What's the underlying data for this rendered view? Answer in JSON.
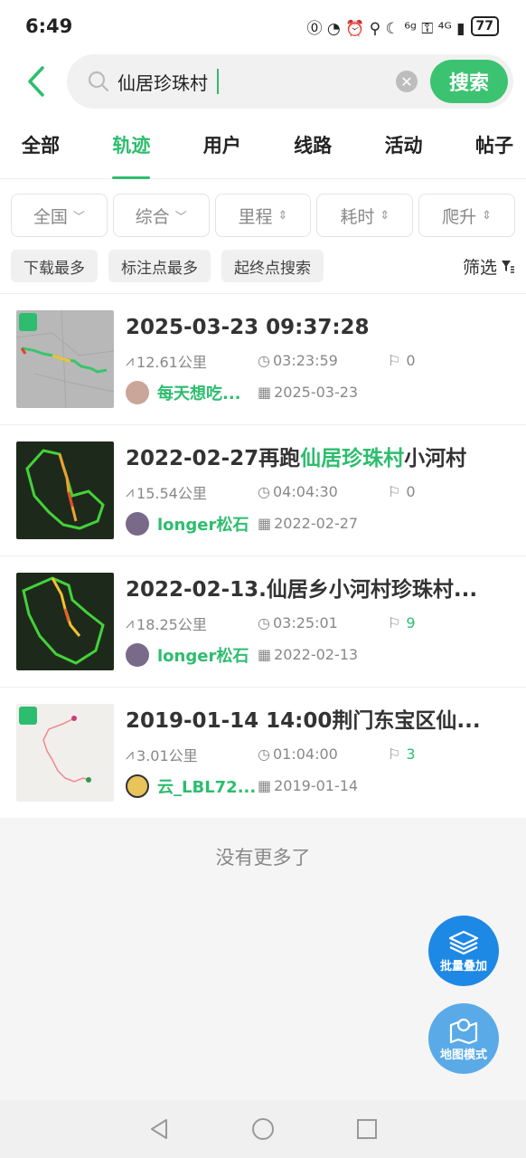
{
  "status_bar": {
    "time": "6:49",
    "icons_text": "⓪ ◔ ⏰ ⚲ ☾ ⁶ᵍ ⚿ ⁴ᴳ ▮",
    "battery": "77"
  },
  "search": {
    "query": "仙居珍珠村",
    "button_label": "搜索"
  },
  "tabs": [
    {
      "label": "全部",
      "active": false
    },
    {
      "label": "轨迹",
      "active": true
    },
    {
      "label": "用户",
      "active": false
    },
    {
      "label": "线路",
      "active": false
    },
    {
      "label": "活动",
      "active": false
    },
    {
      "label": "帖子",
      "active": false
    }
  ],
  "dropdowns": [
    {
      "label": "全国",
      "arrow": "﹀"
    },
    {
      "label": "综合",
      "arrow": "﹀"
    },
    {
      "label": "里程",
      "arrow": "⇕"
    },
    {
      "label": "耗时",
      "arrow": "⇕"
    },
    {
      "label": "爬升",
      "arrow": "⇕"
    }
  ],
  "chips": [
    "下载最多",
    "标注点最多",
    "起终点搜索"
  ],
  "filter_label": "筛选",
  "tracks": [
    {
      "title_pre": "2025-03-23 09:37:28",
      "title_hl": "",
      "title_post": "",
      "distance": "12.61公里",
      "duration": "03:23:59",
      "marks": "0",
      "user": "每天想吃...",
      "date": "2025-03-23"
    },
    {
      "title_pre": "2022-02-27再跑",
      "title_hl": "仙居珍珠村",
      "title_post": "小河村",
      "distance": "15.54公里",
      "duration": "04:04:30",
      "marks": "0",
      "user": "longer松石",
      "date": "2022-02-27"
    },
    {
      "title_pre": "2022-02-13.仙居乡小河村珍珠村...",
      "title_hl": "",
      "title_post": "",
      "distance": "18.25公里",
      "duration": "03:25:01",
      "marks": "9",
      "user": "longer松石",
      "date": "2022-02-13"
    },
    {
      "title_pre": "2019-01-14 14:00荆门东宝区仙...",
      "title_hl": "",
      "title_post": "",
      "distance": "3.01公里",
      "duration": "01:04:00",
      "marks": "3",
      "user": "云_LBL72...",
      "date": "2019-01-14"
    }
  ],
  "no_more": "没有更多了",
  "fab": {
    "batch_overlay": "批量叠加",
    "map_mode": "地图模式"
  },
  "colors": {
    "accent": "#2dbd6e",
    "fab_primary": "#1e88e5",
    "fab_secondary": "#5aaae8"
  }
}
